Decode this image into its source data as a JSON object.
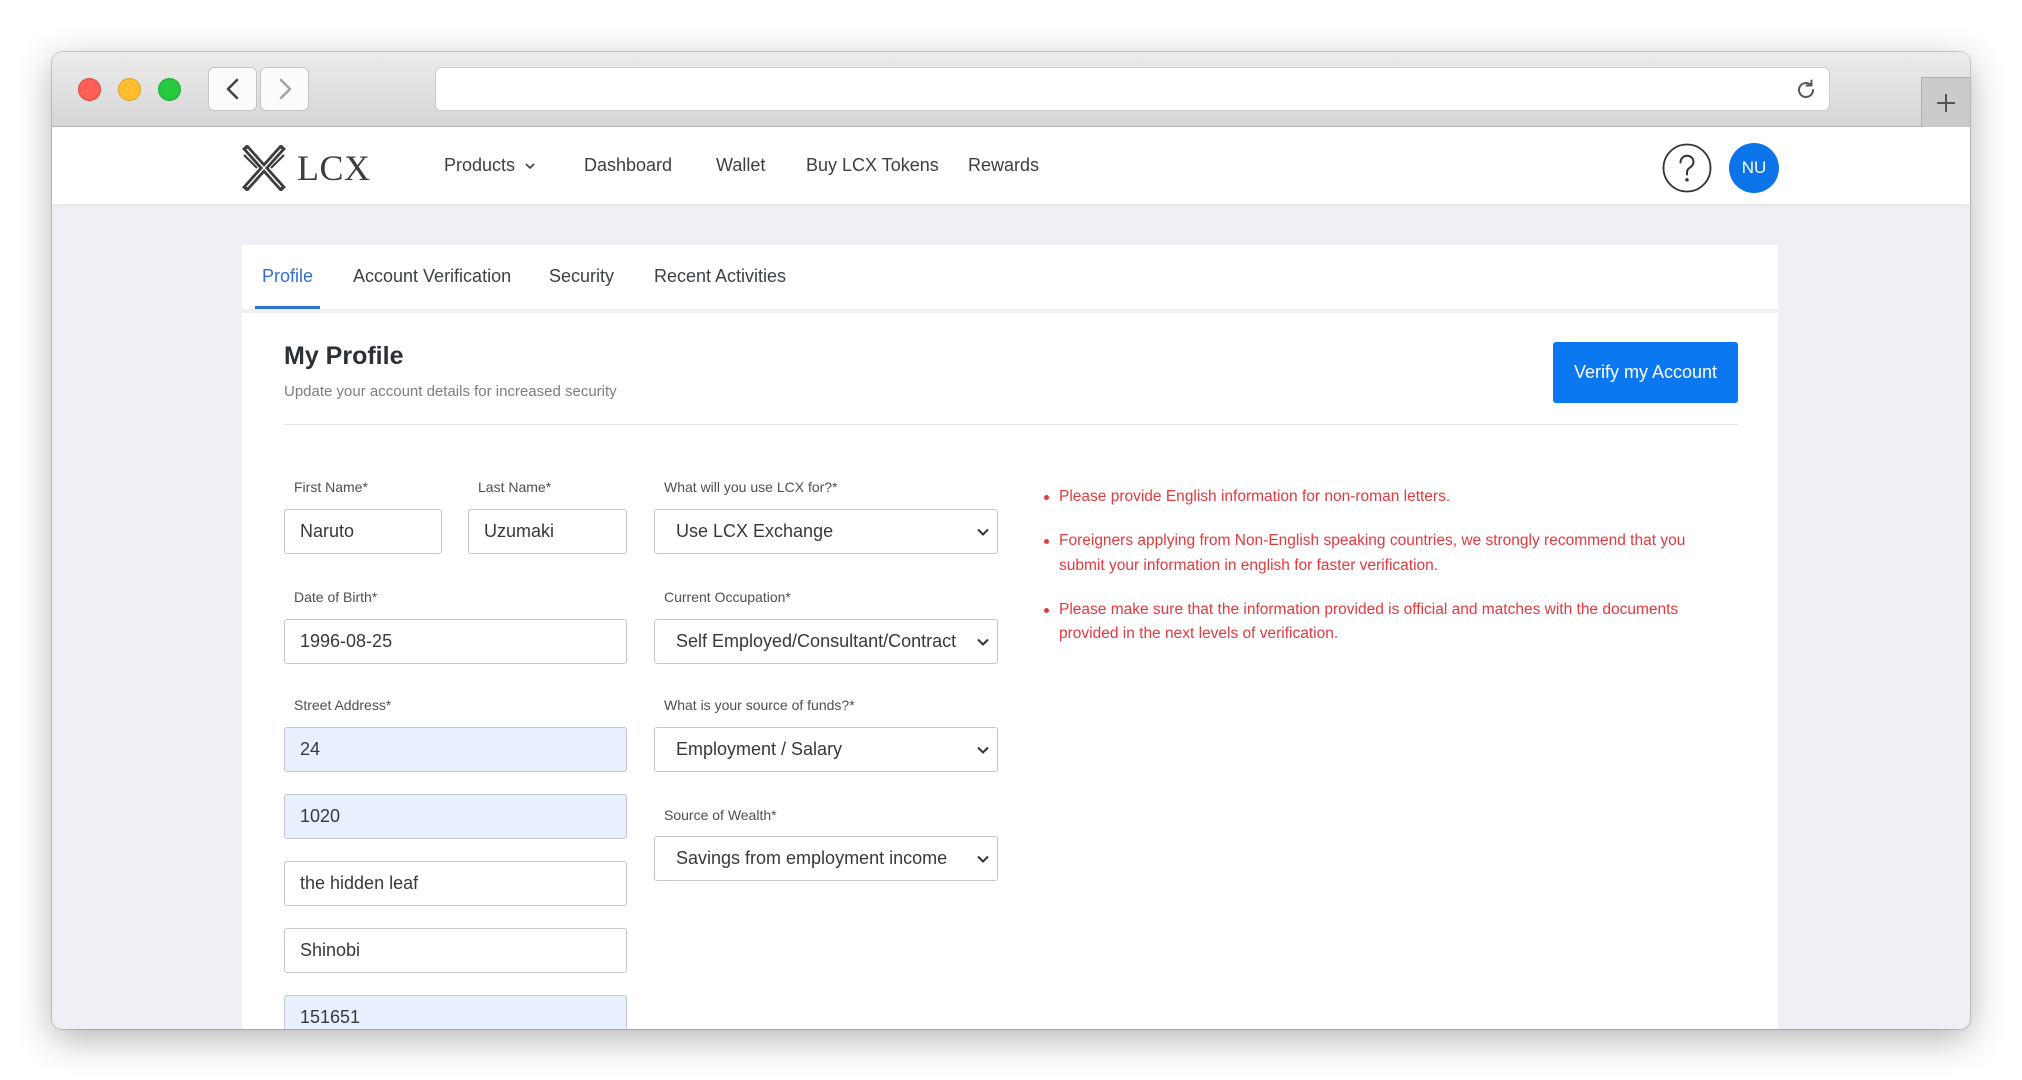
{
  "browser": {
    "icons": {
      "back": "chevron-left-icon",
      "forward": "chevron-right-icon",
      "reload": "reload-icon",
      "new_tab": "plus-icon"
    }
  },
  "header": {
    "logo_text": "LCX",
    "logo_icon": "lcx-logo-icon",
    "nav": [
      {
        "label": "Products",
        "icon": "chevron-down-icon"
      },
      {
        "label": "Dashboard"
      },
      {
        "label": "Wallet"
      },
      {
        "label": "Buy LCX Tokens"
      },
      {
        "label": "Rewards"
      }
    ],
    "help_icon": "question-circle-icon",
    "avatar_initials": "NU"
  },
  "tabs": [
    {
      "label": "Profile",
      "active": true
    },
    {
      "label": "Account Verification",
      "active": false
    },
    {
      "label": "Security",
      "active": false
    },
    {
      "label": "Recent Activities",
      "active": false
    }
  ],
  "profile": {
    "title": "My Profile",
    "subtitle": "Update your account details for increased security",
    "verify_button_label": "Verify my Account"
  },
  "form": {
    "first_name": {
      "label": "First Name*",
      "value": "Naruto"
    },
    "last_name": {
      "label": "Last Name*",
      "value": "Uzumaki"
    },
    "date_of_birth": {
      "label": "Date of Birth*",
      "value": "1996-08-25"
    },
    "street_address": {
      "label": "Street Address*",
      "lines": [
        {
          "value": "24",
          "autofilled": true
        },
        {
          "value": "1020",
          "autofilled": true
        },
        {
          "value": "the hidden leaf",
          "autofilled": false
        },
        {
          "value": "Shinobi",
          "autofilled": false
        },
        {
          "value": "151651",
          "autofilled": true
        }
      ]
    },
    "use_lcx_for": {
      "label": "What will you use LCX for?*",
      "value": "Use LCX Exchange"
    },
    "occupation": {
      "label": "Current Occupation*",
      "value": "Self Employed/Consultant/Contract"
    },
    "source_of_funds": {
      "label": "What is your source of funds?*",
      "value": "Employment / Salary"
    },
    "source_of_wealth": {
      "label": "Source of Wealth*",
      "value": "Savings from employment income"
    },
    "select_icon": "chevron-down-icon"
  },
  "notices": [
    "Please provide English information for non-roman letters.",
    "Foreigners applying from Non-English speaking countries, we strongly recommend that you submit your information in english for faster verification.",
    "Please make sure that the information provided is official and matches with the documents provided in the next levels of verification."
  ],
  "colors": {
    "accent": "#0b77f0",
    "tab_active": "#2f6fd6",
    "notice_red": "#e2393e",
    "autofill_bg": "#e8f0fe",
    "page_bg": "#eef0f4",
    "avatar_bg": "#0b74e8"
  }
}
